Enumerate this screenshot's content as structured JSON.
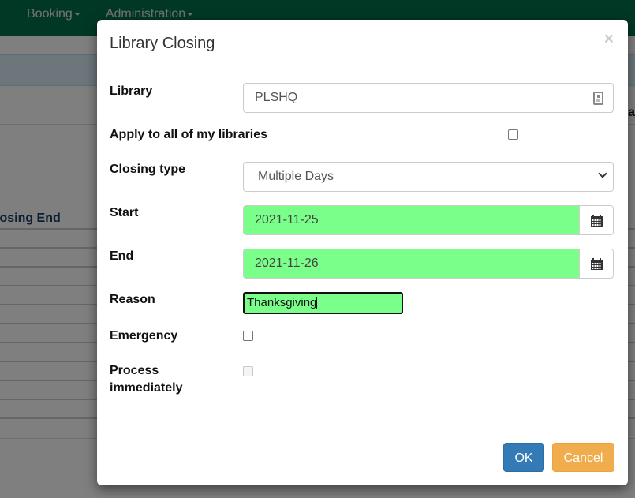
{
  "navbar": {
    "items": [
      {
        "label": "Booking"
      },
      {
        "label": "Administration"
      }
    ]
  },
  "background": {
    "table_header_left": "losing End",
    "table_header_right": "at"
  },
  "modal": {
    "title": "Library Closing",
    "close_glyph": "×",
    "fields": {
      "library": {
        "label": "Library",
        "value": "PLSHQ",
        "icon": "contact-card-icon"
      },
      "apply_all": {
        "label": "Apply to all of my libraries",
        "checked": false
      },
      "closing_type": {
        "label": "Closing type",
        "value": "Multiple Days"
      },
      "start": {
        "label": "Start",
        "value": "2021-11-25",
        "icon": "calendar-icon"
      },
      "end": {
        "label": "End",
        "value": "2021-11-26",
        "icon": "calendar-icon"
      },
      "reason": {
        "label": "Reason",
        "value": "Thanksgiving"
      },
      "emergency": {
        "label": "Emergency",
        "checked": false
      },
      "process_immediately": {
        "label_line1": "Process",
        "label_line2": "immediately",
        "checked": false,
        "disabled": true
      }
    },
    "buttons": {
      "ok": "OK",
      "cancel": "Cancel"
    }
  },
  "colors": {
    "navbar": "#00704a",
    "valid_field": "#7aff8a",
    "primary": "#337ab7",
    "warning": "#f0ad4e"
  }
}
